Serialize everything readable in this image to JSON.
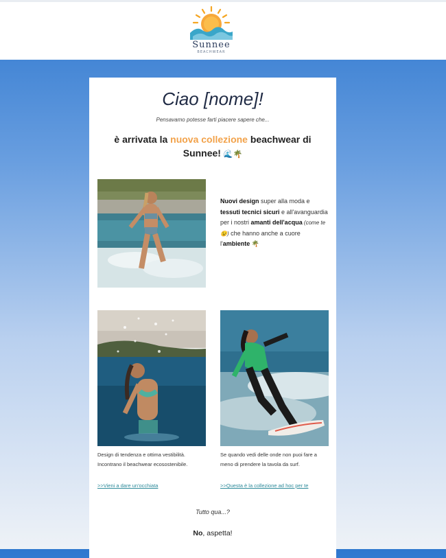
{
  "header": {
    "brand": "Sunnee",
    "brand_sub": "BEACHWEAR",
    "logo_icon": "sun-over-waves-icon"
  },
  "colors": {
    "accent": "#f2a24a",
    "link": "#2d8a9a",
    "logo_sun": "#f5a623",
    "logo_wave": "#3aa6c9"
  },
  "email": {
    "greeting": "Ciao [nome]!",
    "intro": "Pensavamo potesse farti piacere sapere che...",
    "headline": {
      "pre": "è arrivata la ",
      "accent": "nuova collezione",
      "post": " beachwear di Sunnee!",
      "emojis": "🌊🌴"
    },
    "feature": {
      "b1": "Nuovi design",
      "t1": " super alla moda e ",
      "b2": "tessuti tecnici sicuri",
      "t2": " e all'avanguardia per i nostri ",
      "b3": "amanti dell'acqua",
      "i1": " (come te 😉)",
      "t3": " che hanno anche a cuore l'",
      "b4": "ambiente",
      "emoji": " 🌴"
    },
    "items": [
      {
        "caption": "Design di tendenza e ottima vestibilità. Incontrano il beachwear ecosostenibile.",
        "link": ">>Vieni a dare un'occhiata"
      },
      {
        "caption": "Se quando vedi delle onde non puoi fare a meno di prendere la tavola da surf.",
        "link": ">>Questa è la collezione ad hoc per te"
      }
    ],
    "tutto": "Tutto qua...?",
    "aspetta_bold": "No",
    "aspetta_rest": ", aspetta!"
  }
}
